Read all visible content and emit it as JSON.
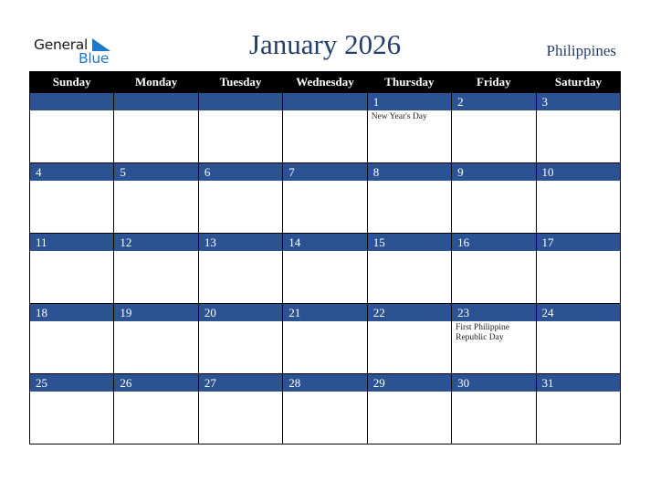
{
  "logo": {
    "line1": "General",
    "line2": "Blue"
  },
  "title": "January 2026",
  "country": "Philippines",
  "colors": {
    "header_bg": "#000000",
    "date_bar": "#2b5394",
    "title": "#243f6b",
    "logo_blue": "#1f78c8"
  },
  "weekdays": [
    "Sunday",
    "Monday",
    "Tuesday",
    "Wednesday",
    "Thursday",
    "Friday",
    "Saturday"
  ],
  "weeks": [
    [
      {
        "day": "",
        "holiday": ""
      },
      {
        "day": "",
        "holiday": ""
      },
      {
        "day": "",
        "holiday": ""
      },
      {
        "day": "",
        "holiday": ""
      },
      {
        "day": "1",
        "holiday": "New Year's Day"
      },
      {
        "day": "2",
        "holiday": ""
      },
      {
        "day": "3",
        "holiday": ""
      }
    ],
    [
      {
        "day": "4",
        "holiday": ""
      },
      {
        "day": "5",
        "holiday": ""
      },
      {
        "day": "6",
        "holiday": ""
      },
      {
        "day": "7",
        "holiday": ""
      },
      {
        "day": "8",
        "holiday": ""
      },
      {
        "day": "9",
        "holiday": ""
      },
      {
        "day": "10",
        "holiday": ""
      }
    ],
    [
      {
        "day": "11",
        "holiday": ""
      },
      {
        "day": "12",
        "holiday": ""
      },
      {
        "day": "13",
        "holiday": ""
      },
      {
        "day": "14",
        "holiday": ""
      },
      {
        "day": "15",
        "holiday": ""
      },
      {
        "day": "16",
        "holiday": ""
      },
      {
        "day": "17",
        "holiday": ""
      }
    ],
    [
      {
        "day": "18",
        "holiday": ""
      },
      {
        "day": "19",
        "holiday": ""
      },
      {
        "day": "20",
        "holiday": ""
      },
      {
        "day": "21",
        "holiday": ""
      },
      {
        "day": "22",
        "holiday": ""
      },
      {
        "day": "23",
        "holiday": "First Philippine Republic Day"
      },
      {
        "day": "24",
        "holiday": ""
      }
    ],
    [
      {
        "day": "25",
        "holiday": ""
      },
      {
        "day": "26",
        "holiday": ""
      },
      {
        "day": "27",
        "holiday": ""
      },
      {
        "day": "28",
        "holiday": ""
      },
      {
        "day": "29",
        "holiday": ""
      },
      {
        "day": "30",
        "holiday": ""
      },
      {
        "day": "31",
        "holiday": ""
      }
    ]
  ]
}
